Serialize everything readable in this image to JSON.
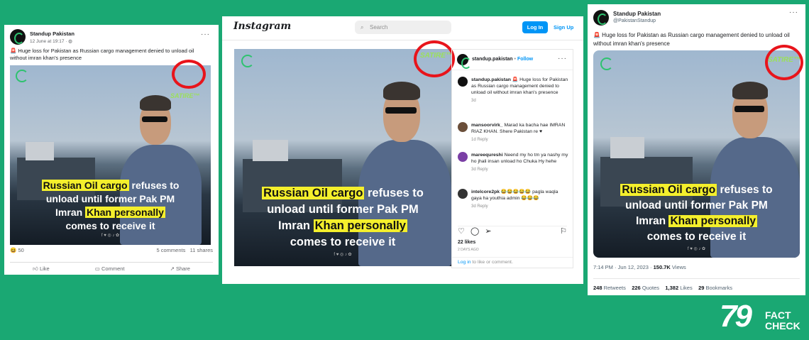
{
  "facebook": {
    "page_name": "Standup Pakistan",
    "time": "12 June at 19:17 · ",
    "caption": "🚨 Huge loss for Pakistan as Russian cargo management denied to unload oil without imran khan's presence",
    "reaction_count": "50",
    "comments": "5 comments",
    "shares": "11 shares",
    "like": "Like",
    "comment": "Comment",
    "share": "Share"
  },
  "image": {
    "satire_badge": "SATIRE™",
    "line1_hl": "Russian Oil cargo",
    "line1_rest": " refuses to",
    "line2": "unload until former Pak PM",
    "line3_pre": "Imran ",
    "line3_hl": "Khan personally",
    "line4": "comes to receive it",
    "socials": "f ♥ ◎ ♪ ✿"
  },
  "instagram": {
    "logo": "Instagram",
    "search_placeholder": "Search",
    "login": "Log In",
    "signup": "Sign Up",
    "username": "standup.pakistan",
    "follow": "Follow",
    "caption_user": "standup.pakistan",
    "caption": " 🚨 Huge loss for Pakistan as Russian cargo management denied to unload oil without imran khan's presence",
    "caption_age": "3d",
    "comments": [
      {
        "user": "mansoorvirk_",
        "text": " Marad ka bacha hae IMRAN RIAZ KHAN. Shere Pakistan re ♥",
        "meta": "1d   Reply"
      },
      {
        "user": "mareequreshi",
        "text": " Neend my ho tm ya nashy my ho jhali insan unload ho Chuka Hy hehe",
        "meta": "3d   Reply"
      },
      {
        "user": "intelcore2pk",
        "text": " 😂😂😂😂😂 pagla waqla gaya ha youthia admin 😂😂😂",
        "meta": "3d   Reply"
      }
    ],
    "likes": "22 likes",
    "age": "2 DAYS AGO",
    "login_prompt_link": "Log in",
    "login_prompt_rest": " to like or comment."
  },
  "twitter": {
    "name": "Standup Pakistan",
    "handle": "@PakistanStandup",
    "text": "🚨 Huge loss for Pakistan as Russian cargo management denied to unload oil without imran khan's presence",
    "timestamp": "7:14 PM · Jun 12, 2023 · ",
    "views": "150.7K",
    "views_label": " Views",
    "retweets": "248",
    "retweets_label": " Retweets",
    "quotes": "226",
    "quotes_label": " Quotes",
    "likes": "1,382",
    "likes_label": " Likes",
    "bookmarks": "29",
    "bookmarks_label": " Bookmarks"
  },
  "factcheck": {
    "number": "79",
    "line1": "FACT",
    "line2": "CHECK"
  },
  "colors": {
    "background": "#1aa873",
    "annotation_ring": "#e8141b",
    "highlight": "#f4ef2c",
    "instagram_blue": "#0095f6"
  }
}
